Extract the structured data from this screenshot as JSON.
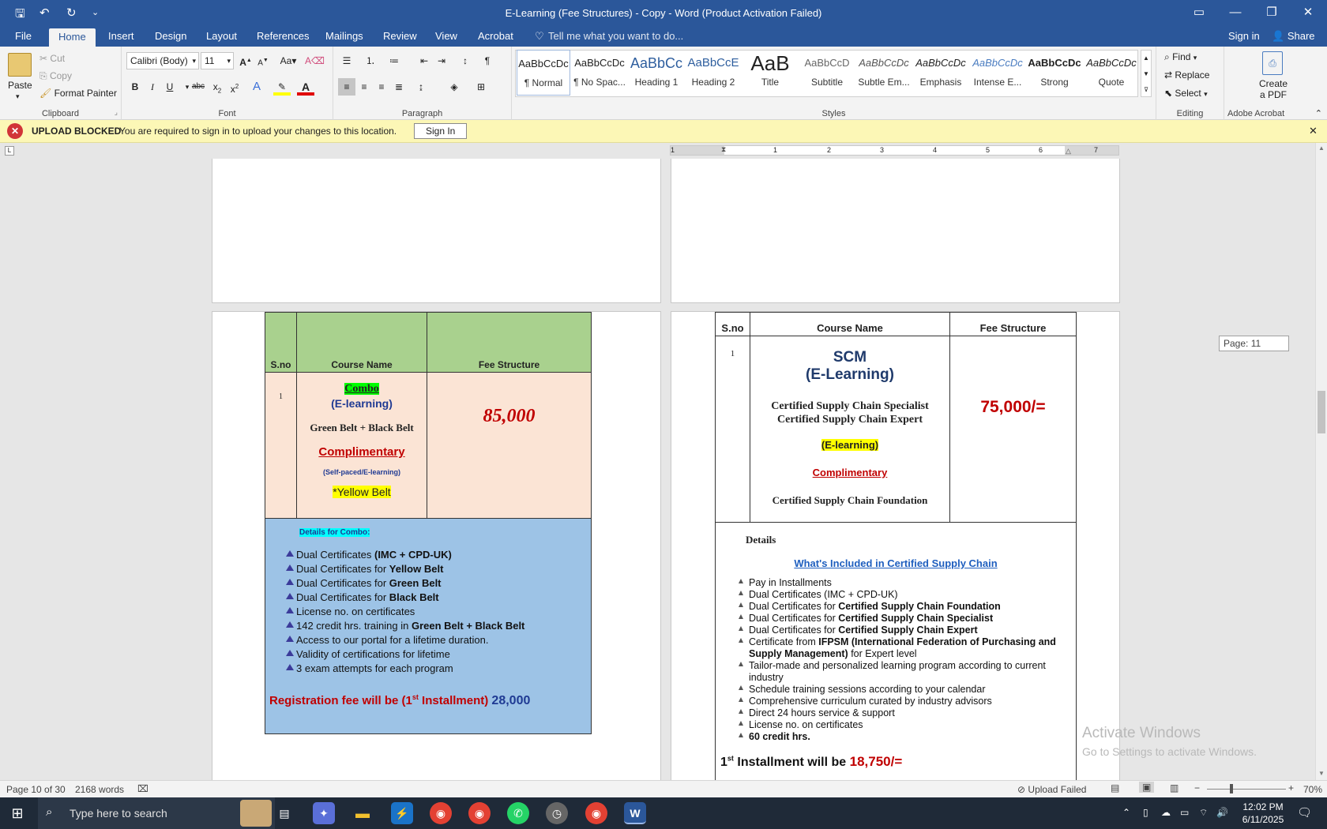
{
  "window": {
    "title": "E-Learning (Fee Structures) - Copy - Word (Product Activation Failed)"
  },
  "quick_access": {
    "save": "🖫",
    "undo": "↶",
    "redo": "↻",
    "more": "⌄"
  },
  "tabs": [
    "File",
    "Home",
    "Insert",
    "Design",
    "Layout",
    "References",
    "Mailings",
    "Review",
    "View",
    "Acrobat"
  ],
  "tell_me": "Tell me what you want to do...",
  "sign_in": "Sign in",
  "share": "Share",
  "clipboard": {
    "paste": "Paste",
    "cut": "Cut",
    "copy": "Copy",
    "format_painter": "Format Painter",
    "label": "Clipboard"
  },
  "font": {
    "name": "Calibri (Body)",
    "size": "11",
    "label": "Font"
  },
  "paragraph": {
    "label": "Paragraph"
  },
  "styles": {
    "label": "Styles",
    "items": [
      {
        "preview": "AaBbCcDc",
        "name": "¶ Normal"
      },
      {
        "preview": "AaBbCcDc",
        "name": "¶ No Spac..."
      },
      {
        "preview": "AaBbCc",
        "name": "Heading 1"
      },
      {
        "preview": "AaBbCcE",
        "name": "Heading 2"
      },
      {
        "preview": "AaB",
        "name": "Title"
      },
      {
        "preview": "AaBbCcD",
        "name": "Subtitle"
      },
      {
        "preview": "AaBbCcDc",
        "name": "Subtle Em..."
      },
      {
        "preview": "AaBbCcDc",
        "name": "Emphasis"
      },
      {
        "preview": "AaBbCcDc",
        "name": "Intense E..."
      },
      {
        "preview": "AaBbCcDc",
        "name": "Strong"
      },
      {
        "preview": "AaBbCcDc",
        "name": "Quote"
      }
    ]
  },
  "editing": {
    "find": "Find",
    "replace": "Replace",
    "select": "Select",
    "label": "Editing"
  },
  "acrobat": {
    "create_line1": "Create",
    "create_line2": "a PDF",
    "label": "Adobe Acrobat"
  },
  "message": {
    "title": "UPLOAD BLOCKED",
    "text": "You are required to sign in to upload your changes to this location.",
    "button": "Sign In"
  },
  "ruler": {
    "ticks": [
      "1",
      "1",
      "2",
      "3",
      "4",
      "5",
      "6",
      "7"
    ]
  },
  "page_tooltip": "Page: 11",
  "left_table": {
    "headers": [
      "S.no",
      "Course Name",
      "Fee Structure"
    ],
    "sno": "1",
    "combo": "Combo",
    "elearning": "(E-learning)",
    "belts": "Green Belt + Black Belt",
    "complimentary": "Complimentary",
    "selfpaced": "(Self-paced/E-learning)",
    "yellow": "*Yellow Belt",
    "fee": "85,000",
    "details_title": "Details for Combo:",
    "details": [
      {
        "pre": "Dual Certificates ",
        "bold": "(IMC + CPD-UK)"
      },
      {
        "pre": "Dual Certificates for ",
        "bold": "Yellow Belt"
      },
      {
        "pre": "Dual Certificates for ",
        "bold": "Green Belt"
      },
      {
        "pre": "Dual Certificates for ",
        "bold": "Black Belt"
      },
      {
        "pre": "License no. on certificates",
        "bold": ""
      },
      {
        "pre": "142 credit hrs. training in ",
        "bold": "Green Belt + Black Belt"
      },
      {
        "pre": "Access to our portal for a lifetime duration.",
        "bold": ""
      },
      {
        "pre": "Validity of certifications for lifetime",
        "bold": ""
      },
      {
        "pre": "3 exam attempts for each program",
        "bold": ""
      }
    ],
    "reg_pre": "Registration fee will be (1",
    "reg_sup": "st",
    "reg_post": " Installment)",
    "reg_amount": "28,000"
  },
  "right_table": {
    "headers": [
      "S.no",
      "Course Name",
      "Fee Structure"
    ],
    "sno": "1",
    "scm": "SCM",
    "elearning": "(E-Learning)",
    "cert1": "Certified Supply Chain Specialist",
    "cert2": "Certified Supply Chain Expert",
    "elearning2": "(E-learning)",
    "complimentary": "Complimentary",
    "foundation": "Certified Supply Chain Foundation",
    "fee": "75,000/=",
    "details_title": "Details",
    "included": "What's Included in Certified Supply Chain",
    "details": [
      {
        "pre": "Pay in Installments",
        "bold": "",
        "post": ""
      },
      {
        "pre": "Dual Certificates (IMC + CPD-UK)",
        "bold": "",
        "post": ""
      },
      {
        "pre": "Dual Certificates for ",
        "bold": "Certified Supply Chain Foundation",
        "post": ""
      },
      {
        "pre": "Dual Certificates for ",
        "bold": "Certified Supply Chain Specialist",
        "post": ""
      },
      {
        "pre": "Dual Certificates for ",
        "bold": "Certified Supply Chain Expert",
        "post": ""
      },
      {
        "pre": "Certificate from ",
        "bold": "IFPSM (International Federation of Purchasing and Supply Management)",
        "post": " for Expert level"
      },
      {
        "pre": "Tailor-made and personalized learning program according to current industry",
        "bold": "",
        "post": ""
      },
      {
        "pre": "Schedule training sessions according to your calendar",
        "bold": "",
        "post": ""
      },
      {
        "pre": "Comprehensive curriculum curated by industry advisors",
        "bold": "",
        "post": ""
      },
      {
        "pre": "Direct 24 hours service & support",
        "bold": "",
        "post": ""
      },
      {
        "pre": "License no. on certificates",
        "bold": "",
        "post": ""
      },
      {
        "pre": "",
        "bold": "60 credit hrs.",
        "post": ""
      }
    ],
    "inst_num": "1",
    "inst_sup": "st",
    "inst_text": " Installment will be ",
    "inst_amount": "18,750/="
  },
  "watermark": {
    "line1": "Activate Windows",
    "line2": "Go to Settings to activate Windows."
  },
  "status": {
    "page": "Page 10 of 30",
    "words": "2168 words",
    "upload": "Upload Failed",
    "zoom": "70%"
  },
  "taskbar": {
    "search": "Type here to search",
    "time": "12:02 PM",
    "date": "6/11/2025"
  }
}
